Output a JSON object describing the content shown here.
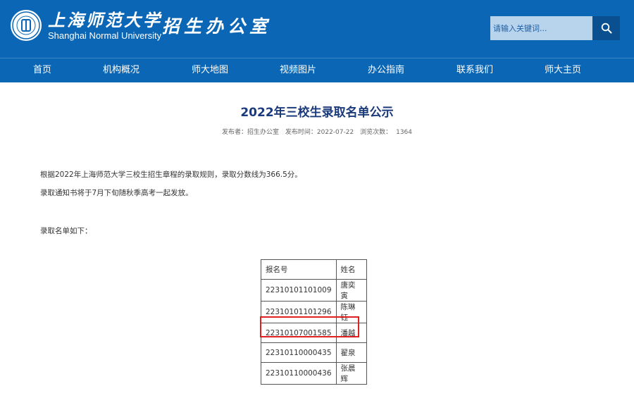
{
  "header": {
    "brand_cn": "上海师范大学",
    "brand_en": "Shanghai Normal University",
    "office": "招生办公室",
    "search_placeholder": "请输入关键词...",
    "search_icon": "search-icon",
    "brand_color": "#0b67b6"
  },
  "nav": {
    "items": [
      {
        "label": "首页"
      },
      {
        "label": "机构概况"
      },
      {
        "label": "师大地图"
      },
      {
        "label": "视频图片"
      },
      {
        "label": "办公指南"
      },
      {
        "label": "联系我们"
      },
      {
        "label": "师大主页"
      }
    ]
  },
  "article": {
    "title": "2022年三校生录取名单公示",
    "meta": {
      "publisher": "发布者：招生办公室",
      "time": "发布时间：2022-07-22",
      "views_label": "浏览次数：",
      "views": "1364"
    },
    "paragraphs": [
      "根据2022年上海师范大学三校生招生章程的录取规则，录取分数线为366.5分。",
      "录取通知书将于7月下旬随秋季高考一起发放。",
      "录取名单如下："
    ],
    "table": {
      "headers": [
        "报名号",
        "姓名"
      ],
      "rows": [
        [
          "22310101101009",
          "唐奕寅"
        ],
        [
          "22310101101296",
          "陈琳钰"
        ],
        [
          "22310107001585",
          "潘越"
        ],
        [
          "22310110000435",
          "翟泉"
        ],
        [
          "22310110000436",
          "张晨辉"
        ]
      ],
      "highlight_color": "#e02020"
    }
  }
}
